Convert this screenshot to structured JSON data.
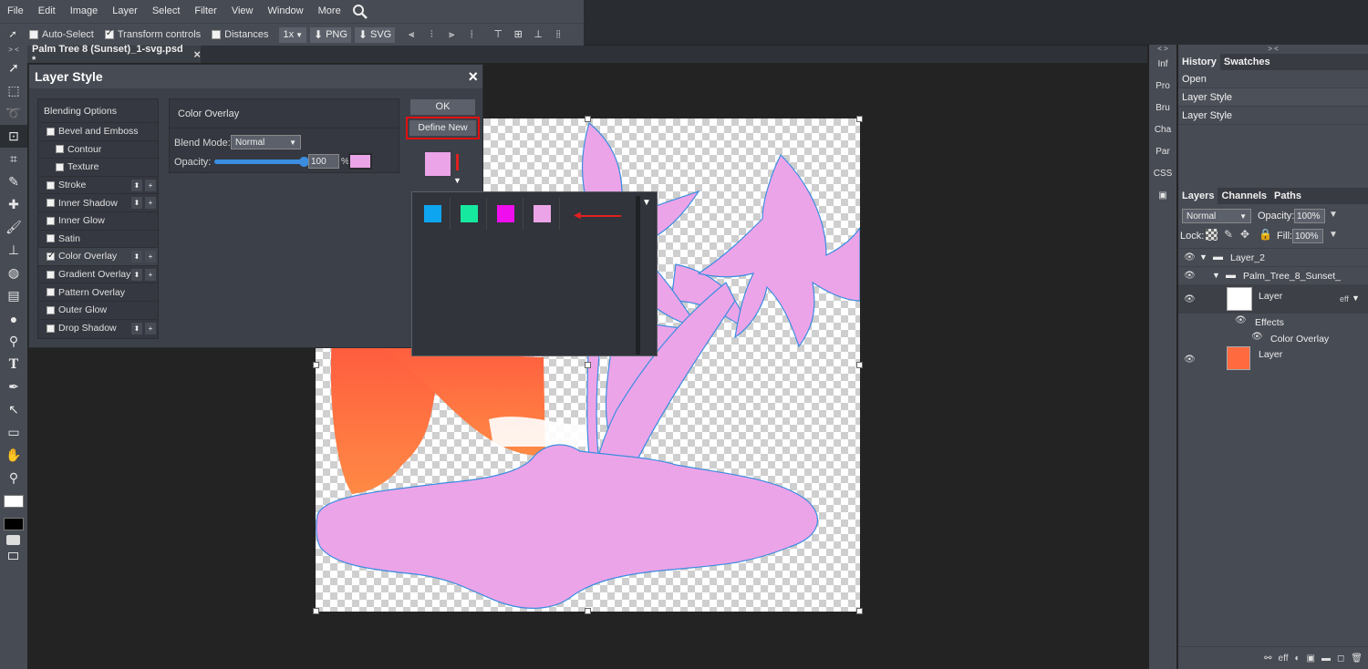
{
  "menu": [
    "File",
    "Edit",
    "Image",
    "Layer",
    "Select",
    "Filter",
    "View",
    "Window",
    "More"
  ],
  "options": {
    "auto_select": "Auto-Select",
    "transform_controls": "Transform controls",
    "distances": "Distances",
    "zoom": "1x",
    "png": "PNG",
    "svg": "SVG"
  },
  "document_tab": {
    "title": "Palm Tree 8 (Sunset)_1-svg.psd *",
    "close": "×"
  },
  "dialog": {
    "title": "Layer Style",
    "close": "×",
    "list_header": "Blending Options",
    "items": [
      {
        "label": "Bevel and Emboss",
        "checked": false
      },
      {
        "label": "Contour",
        "checked": false
      },
      {
        "label": "Texture",
        "checked": false
      },
      {
        "label": "Stroke",
        "checked": false
      },
      {
        "label": "Inner Shadow",
        "checked": false
      },
      {
        "label": "Inner Glow",
        "checked": false
      },
      {
        "label": "Satin",
        "checked": false
      },
      {
        "label": "Color Overlay",
        "checked": true
      },
      {
        "label": "Gradient Overlay",
        "checked": false
      },
      {
        "label": "Pattern Overlay",
        "checked": false
      },
      {
        "label": "Outer Glow",
        "checked": false
      },
      {
        "label": "Drop Shadow",
        "checked": false
      }
    ],
    "settings": {
      "header": "Color Overlay",
      "blend_mode_label": "Blend Mode:",
      "blend_mode_value": "Normal",
      "opacity_label": "Opacity:",
      "opacity_value": "100",
      "opacity_unit": "%",
      "overlay_color": "#eca4e8"
    },
    "ok": "OK",
    "define_new": "Define New"
  },
  "swatch_popup": {
    "swatches": [
      "#0ea5f0",
      "#16e8a0",
      "#ee0eee",
      "#eca4e8"
    ],
    "menu_icon": "▼"
  },
  "right_narrow_tabs": [
    "Inf",
    "Pro",
    "Bru",
    "Cha",
    "Par",
    "CSS"
  ],
  "history": {
    "tabs": [
      "History",
      "Swatches"
    ],
    "items": [
      "Open",
      "Layer Style",
      "Layer Style"
    ]
  },
  "layers": {
    "tabs": [
      "Layers",
      "Channels",
      "Paths"
    ],
    "blend_mode": "Normal",
    "opacity_label": "Opacity:",
    "opacity_value": "100%",
    "lock_label": "Lock:",
    "fill_label": "Fill:",
    "fill_value": "100%",
    "rows": {
      "group1": "Layer_2",
      "group2": "Palm_Tree_8_Sunset_",
      "layer1": "Layer",
      "effects": "Effects",
      "color_overlay": "Color Overlay",
      "layer2": "Layer",
      "eff_badge": "eff"
    }
  },
  "bottom_icons": {
    "eff": "eff"
  }
}
